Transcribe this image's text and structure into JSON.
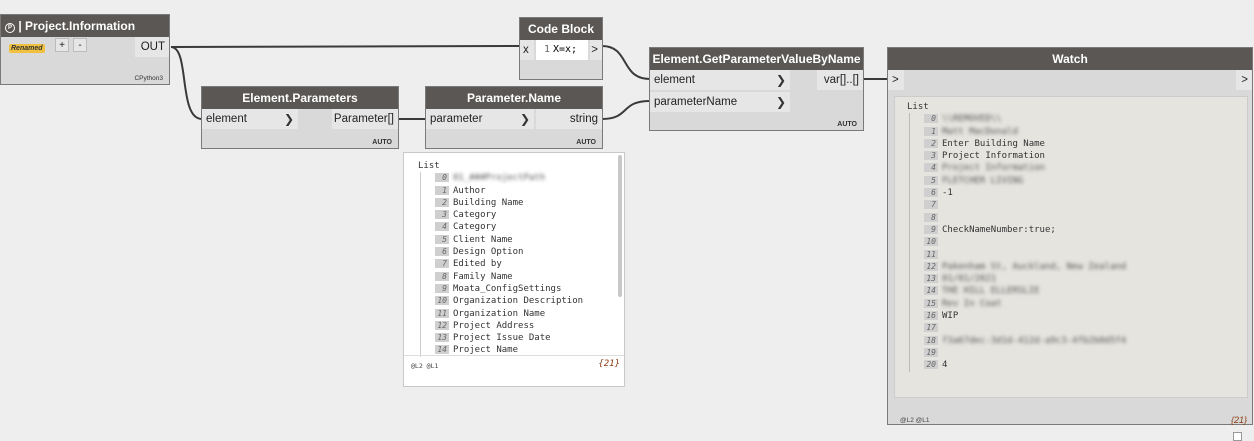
{
  "colors": {
    "header_bg": "#5a5754",
    "canvas_bg": "#eeeeee",
    "node_bg": "#d9d9d9",
    "wire": "#3a3a3a",
    "badge": "#f0c040"
  },
  "nodes": {
    "project_info": {
      "icon": "python-icon",
      "title": "| Project.Information",
      "badge": "Renamed",
      "add_btn": "+",
      "remove_btn": "-",
      "output": "OUT",
      "footer": "CPython3"
    },
    "element_parameters": {
      "title": "Element.Parameters",
      "input": "element",
      "output": "Parameter[]",
      "lacing": "AUTO"
    },
    "parameter_name": {
      "title": "Parameter.Name",
      "input": "parameter",
      "output": "string",
      "lacing": "AUTO"
    },
    "code_block": {
      "title": "Code Block",
      "input": "x",
      "line_no": "1",
      "code": "X=x;",
      "output": ">"
    },
    "get_param": {
      "title": "Element.GetParameterValueByName",
      "input1": "element",
      "input2": "parameterName",
      "output": "var[]..[]",
      "lacing": "AUTO"
    },
    "watch": {
      "title": "Watch",
      "input": ">",
      "output": ">"
    }
  },
  "param_preview": {
    "root": "List",
    "items": [
      {
        "i": "0",
        "text": "01_###ProjectPath",
        "blurred": true
      },
      {
        "i": "1",
        "text": "Author",
        "blurred": false
      },
      {
        "i": "2",
        "text": "Building Name",
        "blurred": false
      },
      {
        "i": "3",
        "text": "Category",
        "blurred": false
      },
      {
        "i": "4",
        "text": "Category",
        "blurred": false
      },
      {
        "i": "5",
        "text": "Client Name",
        "blurred": false
      },
      {
        "i": "6",
        "text": "Design Option",
        "blurred": false
      },
      {
        "i": "7",
        "text": "Edited by",
        "blurred": false
      },
      {
        "i": "8",
        "text": "Family Name",
        "blurred": false
      },
      {
        "i": "9",
        "text": "Moata_ConfigSettings",
        "blurred": false
      },
      {
        "i": "10",
        "text": "Organization Description",
        "blurred": false
      },
      {
        "i": "11",
        "text": "Organization Name",
        "blurred": false
      },
      {
        "i": "12",
        "text": "Project Address",
        "blurred": false
      },
      {
        "i": "13",
        "text": "Project Issue Date",
        "blurred": false
      },
      {
        "i": "14",
        "text": "Project Name",
        "blurred": false
      }
    ],
    "levels": "@L2 @L1",
    "count": "{21}"
  },
  "watch_preview": {
    "root": "List",
    "items": [
      {
        "i": "0",
        "text": "\\\\REMOVED\\\\",
        "blurred": true
      },
      {
        "i": "1",
        "text": "Matt MacDonald",
        "blurred": true
      },
      {
        "i": "2",
        "text": "Enter Building Name",
        "blurred": false
      },
      {
        "i": "3",
        "text": "Project Information",
        "blurred": false
      },
      {
        "i": "4",
        "text": "Project Information",
        "blurred": true
      },
      {
        "i": "5",
        "text": "FLETCHER LIVING",
        "blurred": true
      },
      {
        "i": "6",
        "text": "-1",
        "blurred": false
      },
      {
        "i": "7",
        "text": "",
        "blurred": false
      },
      {
        "i": "8",
        "text": "",
        "blurred": false
      },
      {
        "i": "9",
        "text": "CheckNameNumber:true;",
        "blurred": false
      },
      {
        "i": "10",
        "text": "",
        "blurred": false
      },
      {
        "i": "11",
        "text": "",
        "blurred": false
      },
      {
        "i": "12",
        "text": "Pakenham St, Auckland, New Zealand",
        "blurred": true
      },
      {
        "i": "13",
        "text": "01/01/2021",
        "blurred": true
      },
      {
        "i": "14",
        "text": "THE HILL ELLERSLIE",
        "blurred": true
      },
      {
        "i": "15",
        "text": "Rev In Coat",
        "blurred": true
      },
      {
        "i": "16",
        "text": "WIP",
        "blurred": false
      },
      {
        "i": "17",
        "text": "",
        "blurred": false
      },
      {
        "i": "18",
        "text": "f3a67dec-3d1d-412d-a9c3-4fb2b0d5f4",
        "blurred": true
      },
      {
        "i": "19",
        "text": "",
        "blurred": false
      },
      {
        "i": "20",
        "text": "4",
        "blurred": false
      }
    ],
    "levels": "@L2 @L1",
    "count": "{21}"
  }
}
